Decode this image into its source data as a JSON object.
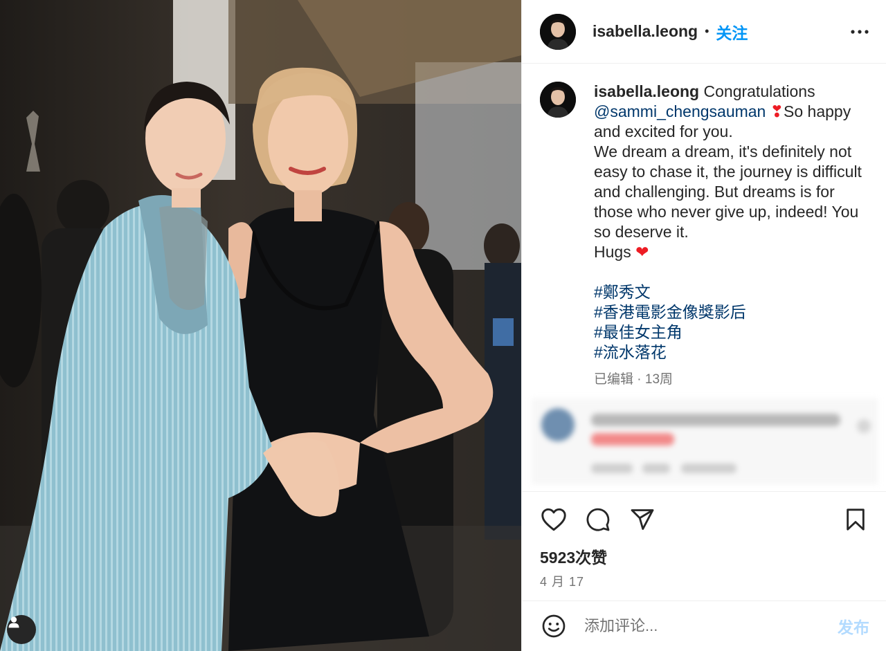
{
  "post": {
    "username": "isabella.leong",
    "follow_label": "关注",
    "caption": {
      "line1_text": " Congratulations",
      "mention": "@sammi_chengsauman",
      "line2_text": "So happy and excited for you.",
      "paragraph": "We dream a dream, it's definitely not easy to chase it, the journey is difficult and challenging. But dreams is for those who never give up, indeed! You so deserve it.",
      "hugs": "Hugs"
    },
    "hashtags": [
      "#鄭秀文",
      "#香港電影金像獎影后",
      "#最佳女主角",
      "#流水落花"
    ],
    "edited_label": "已编辑",
    "separator": " · ",
    "time_ago": "13周",
    "likes": "5923次赞",
    "date": "4 月 17"
  },
  "comment_box": {
    "placeholder": "添加评论...",
    "post_label": "发布"
  },
  "icons": {
    "more": "more-options-icon",
    "like": "heart-icon",
    "comment": "comment-icon",
    "share": "share-icon",
    "save": "bookmark-icon",
    "emoji": "emoji-icon",
    "tag_user": "user-tag-icon"
  },
  "colors": {
    "link_blue": "#0095f6",
    "hashtag_blue": "#00376b",
    "heart_red": "#ed1c24",
    "secondary_text": "#737373"
  }
}
